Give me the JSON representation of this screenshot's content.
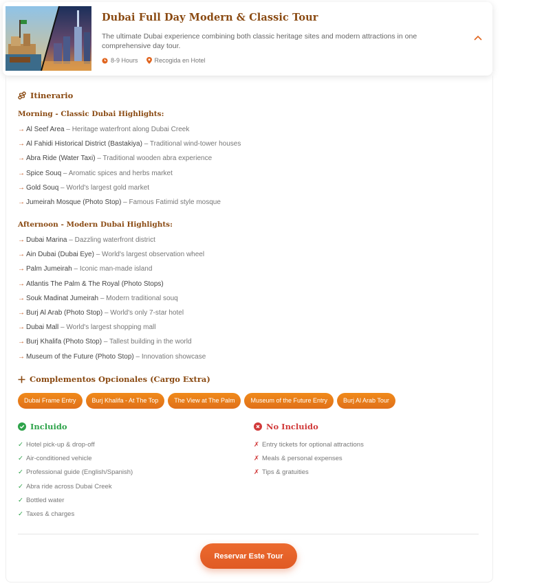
{
  "header": {
    "title": "Dubai Full Day Modern & Classic Tour",
    "description": "The ultimate Dubai experience combining both classic heritage sites and modern attractions in one comprehensive day tour.",
    "duration": "8-9 Hours",
    "pickup": "Recogida en Hotel"
  },
  "itinerary": {
    "heading": "Itinerario",
    "morning": {
      "title": "Morning - Classic Dubai Highlights:",
      "items": [
        {
          "name": "Al Seef Area",
          "desc": " – Heritage waterfront along Dubai Creek"
        },
        {
          "name": "Al Fahidi Historical District (Bastakiya)",
          "desc": " – Traditional wind-tower houses"
        },
        {
          "name": "Abra Ride (Water Taxi)",
          "desc": " – Traditional wooden abra experience"
        },
        {
          "name": "Spice Souq",
          "desc": " – Aromatic spices and herbs market"
        },
        {
          "name": "Gold Souq",
          "desc": " – World's largest gold market"
        },
        {
          "name": "Jumeirah Mosque (Photo Stop)",
          "desc": " – Famous Fatimid style mosque"
        }
      ]
    },
    "afternoon": {
      "title": "Afternoon - Modern Dubai Highlights:",
      "items": [
        {
          "name": "Dubai Marina",
          "desc": " – Dazzling waterfront district"
        },
        {
          "name": "Ain Dubai (Dubai Eye)",
          "desc": " – World's largest observation wheel"
        },
        {
          "name": "Palm Jumeirah",
          "desc": " – Iconic man-made island"
        },
        {
          "name": "Atlantis The Palm & The Royal (Photo Stops)",
          "desc": ""
        },
        {
          "name": "Souk Madinat Jumeirah",
          "desc": " – Modern traditional souq"
        },
        {
          "name": "Burj Al Arab (Photo Stop)",
          "desc": " – World's only 7-star hotel"
        },
        {
          "name": "Dubai Mall",
          "desc": " – World's largest shopping mall"
        },
        {
          "name": "Burj Khalifa (Photo Stop)",
          "desc": " – Tallest building in the world"
        },
        {
          "name": "Museum of the Future (Photo Stop)",
          "desc": " – Innovation showcase"
        }
      ]
    }
  },
  "extras": {
    "heading": "Complementos Opcionales (Cargo Extra)",
    "tags": [
      "Dubai Frame Entry",
      "Burj Khalifa - At The Top",
      "The View at The Palm",
      "Museum of the Future Entry",
      "Burj Al Arab Tour"
    ]
  },
  "included": {
    "heading": "Incluido",
    "items": [
      "Hotel pick-up & drop-off",
      "Air-conditioned vehicle",
      "Professional guide (English/Spanish)",
      "Abra ride across Dubai Creek",
      "Bottled water",
      "Taxes & charges"
    ]
  },
  "not_included": {
    "heading": "No Incluido",
    "items": [
      "Entry tickets for optional attractions",
      "Meals & personal expenses",
      "Tips & gratuities"
    ]
  },
  "cta": {
    "label": "Reservar Este Tour"
  },
  "colors": {
    "brand": "#8a4a12",
    "accent": "#e8651f",
    "ok": "#2ea34a",
    "no": "#d13a3a"
  },
  "icons": {
    "duration": "clock-icon",
    "pickup": "map-pin-icon",
    "toggle": "chevron-up-icon",
    "itinerary": "route-icon",
    "extras": "plus-icon",
    "included": "check-circle-icon",
    "not_included": "x-circle-icon"
  }
}
